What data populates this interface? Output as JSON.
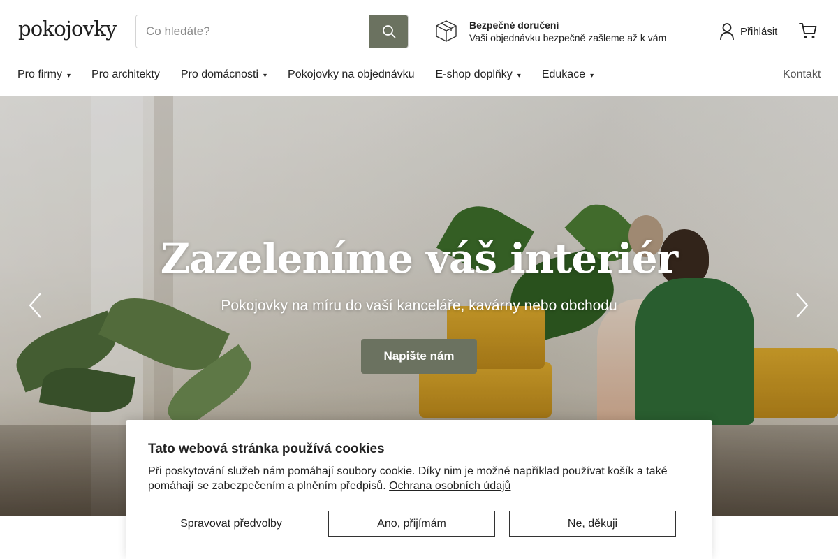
{
  "header": {
    "logo": "pokojovky",
    "search": {
      "placeholder": "Co hledáte?"
    },
    "delivery": {
      "title": "Bezpečné doručení",
      "subtitle": "Vaši objednávku bezpečně zašleme až k vám"
    },
    "login_label": "Přihlásit"
  },
  "nav": {
    "items": [
      {
        "label": "Pro firmy",
        "has_dropdown": true
      },
      {
        "label": "Pro architekty",
        "has_dropdown": false
      },
      {
        "label": "Pro domácnosti",
        "has_dropdown": true
      },
      {
        "label": "Pokojovky na objednávku",
        "has_dropdown": false
      },
      {
        "label": "E-shop doplňky",
        "has_dropdown": true
      },
      {
        "label": "Edukace",
        "has_dropdown": true
      }
    ],
    "contact_label": "Kontakt"
  },
  "hero": {
    "title": "Zazeleníme váš interiér",
    "subtitle": "Pokojovky na míru do vaší kanceláře, kavárny nebo obchodu",
    "cta_label": "Napište nám"
  },
  "cookie": {
    "title": "Tato webová stránka používá cookies",
    "text": "Při poskytování služeb nám pomáhají soubory cookie. Díky nim je možné například používat košík a také pomáhají se zabezpečením a plněním předpisů.",
    "privacy_link": "Ochrana osobních údajů",
    "manage_label": "Spravovat předvolby",
    "accept_label": "Ano, přijímám",
    "decline_label": "Ne, děkuji"
  },
  "colors": {
    "accent": "#6b7260",
    "text": "#222222"
  },
  "icons": {
    "search": "search-icon",
    "package": "package-icon",
    "user": "user-icon",
    "cart": "cart-icon",
    "prev": "chevron-left-icon",
    "next": "chevron-right-icon"
  }
}
